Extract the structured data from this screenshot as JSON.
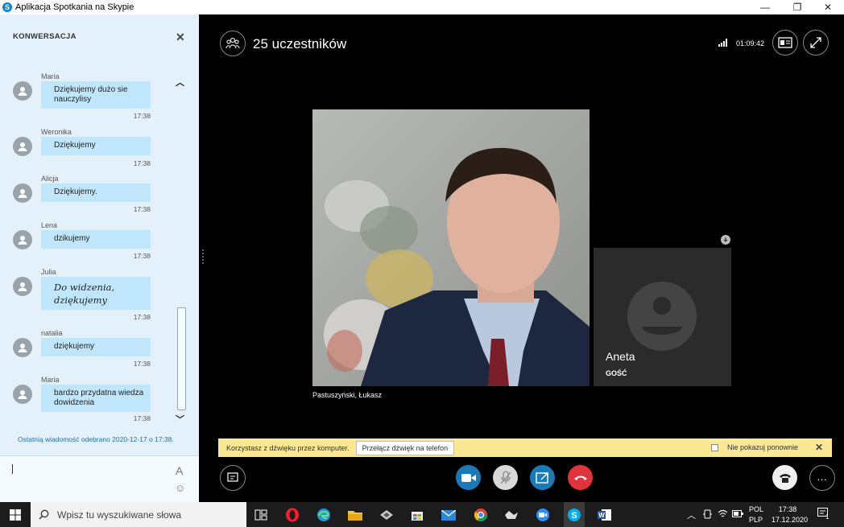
{
  "window": {
    "title": "Aplikacja Spotkania na Skypie"
  },
  "chat": {
    "heading": "KONWERSACJA",
    "messages": [
      {
        "author": "Maria",
        "text": "Dziękujemy dużo sie nauczylisy",
        "time": "17:38"
      },
      {
        "author": "Weronika",
        "text": "Dziękujemy",
        "time": "17:38"
      },
      {
        "author": "Alicja",
        "text": "Dziękujemy.",
        "time": "17:38"
      },
      {
        "author": "Lena",
        "text": "dzikujemy",
        "time": "17:38"
      },
      {
        "author": "Julia",
        "text": "Do widzenia, dziękujemy",
        "time": "17:38"
      },
      {
        "author": "natalia",
        "text": "dziękujemy",
        "time": "17:38"
      },
      {
        "author": "Maria",
        "text": "bardzo przydatna wiedza dowidzenia",
        "time": "17:38"
      }
    ],
    "last_received": "Ostatnią wiadomość odebrano 2020-12-17 o 17:38.",
    "format_glyph": "A"
  },
  "meeting": {
    "participants": "25 uczestników",
    "duration": "01:09:42",
    "presenter_name": "Pastuszyński, Łukasz",
    "guest": {
      "name": "Aneta",
      "role": "GOŚĆ"
    }
  },
  "notice": {
    "text": "Korzystasz z dźwięku przez komputer.",
    "switch_label": "Przełącz dźwięk na telefon",
    "dont_show": "Nie pokazuj ponownie"
  },
  "taskbar": {
    "search_placeholder": "Wpisz tu wyszukiwane słowa",
    "lang_top": "POL",
    "lang_bottom": "PLP",
    "time": "17:38",
    "date": "17.12.2020",
    "notification_count": "1"
  },
  "colors": {
    "accent_blue": "#1a7ab8",
    "hangup_red": "#e0333b",
    "chat_bubble": "#bfe6fb",
    "notice_bg": "#fbe895"
  }
}
